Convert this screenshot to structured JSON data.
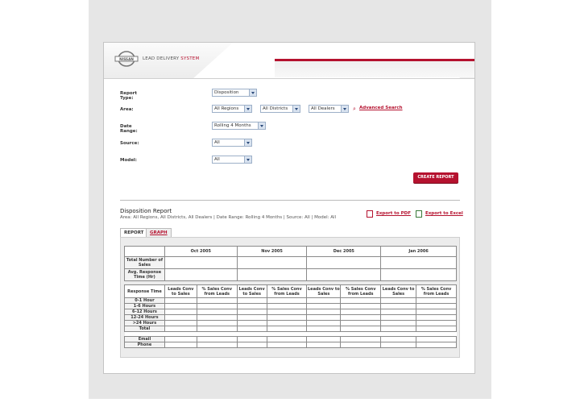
{
  "brand": {
    "logo_text": "NISSAN",
    "system_prefix": "LEAD DELIVERY ",
    "system_accent": "SYSTEM"
  },
  "colors": {
    "accent": "#b5122f",
    "select_border": "#9db0c8"
  },
  "form": {
    "report_type": {
      "label": "Report Type:",
      "value": "Disposition"
    },
    "area": {
      "label": "Area:",
      "region": "All Regions",
      "district": "All Districts",
      "dealer": "All Dealers",
      "advanced_search": "Advanced Search",
      "advanced_icon": "magnifier-icon"
    },
    "date_range": {
      "label": "Date Range:",
      "value": "Rolling 4 Months"
    },
    "source": {
      "label": "Source:",
      "value": "All"
    },
    "model": {
      "label": "Model:",
      "value": "All"
    },
    "create_button": "CREATE REPORT"
  },
  "report": {
    "title": "Disposition Report",
    "subtitle": "Area: All Regions, All Districts, All Dealers | Date Range: Rolling 4 Months | Source: All | Model: All",
    "export_pdf": "Export to PDF",
    "export_excel": "Export to Excel",
    "tabs": [
      "REPORT",
      "GRAPH"
    ],
    "months": [
      "Oct 2005",
      "Nov 2005",
      "Dec 2005",
      "Jan 2006"
    ],
    "summary_rows": [
      "Total Number of Sales",
      "Avg. Response Time (Hr)"
    ],
    "response_header": "Response Time",
    "sub_headers": [
      "Leads Conv to Sales",
      "% Sales Conv from Leads"
    ],
    "response_rows": [
      "0-1 Hour",
      "1-6 Hours",
      "6-12 Hours",
      "12-24 Hours",
      ">24 Hours",
      "Total"
    ],
    "contact_rows": [
      "Email",
      "Phone"
    ]
  }
}
